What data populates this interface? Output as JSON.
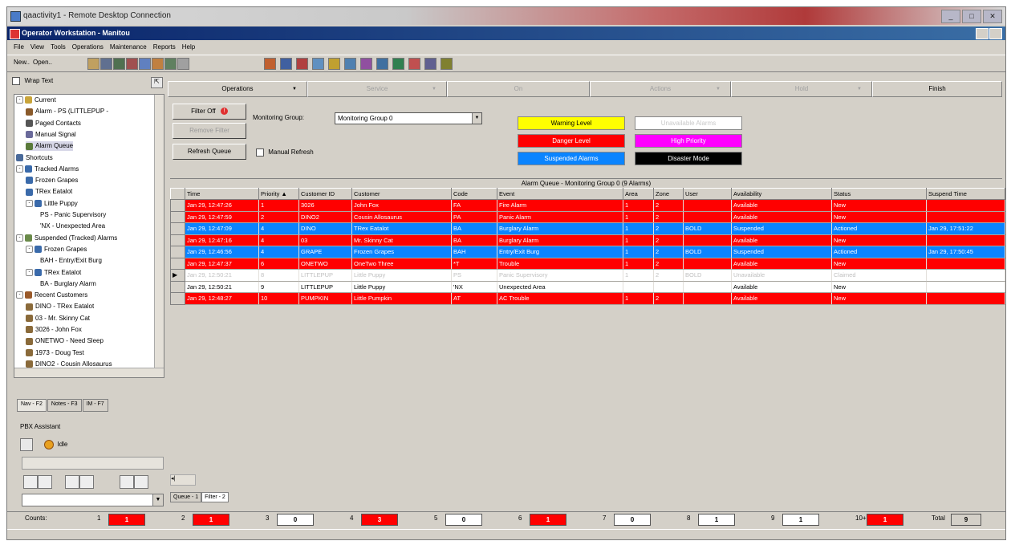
{
  "rdp_window": {
    "title": "qaactivity1 - Remote Desktop Connection"
  },
  "app_window": {
    "title": "Operator Workstation - Manitou"
  },
  "menu": [
    "File",
    "View",
    "Tools",
    "Operations",
    "Maintenance",
    "Reports",
    "Help"
  ],
  "toolbar": {
    "new_label": "New..",
    "open_label": "Open.."
  },
  "left": {
    "wrap_text_label": "Wrap Text",
    "tree": [
      {
        "label": "Current",
        "level": 0,
        "expander": "-",
        "color": "#c9a43a"
      },
      {
        "label": "Alarm - PS (LITTLEPUP -",
        "level": 1,
        "color": "#8a5a2a"
      },
      {
        "label": "Paged Contacts",
        "level": 1,
        "color": "#555555"
      },
      {
        "label": "Manual Signal",
        "level": 1,
        "color": "#6a6a9a"
      },
      {
        "label": "Alarm Queue",
        "level": 1,
        "color": "#5a7a3a",
        "selected": true
      },
      {
        "label": "Shortcuts",
        "level": 0,
        "color": "#4a6a9a"
      },
      {
        "label": "Tracked Alarms",
        "level": 0,
        "expander": "-",
        "color": "#3a6aaa"
      },
      {
        "label": "Frozen Grapes",
        "level": 1,
        "color": "#3a6aaa"
      },
      {
        "label": "TRex Eatalot",
        "level": 1,
        "color": "#3a6aaa"
      },
      {
        "label": "Little Puppy",
        "level": 1,
        "expander": "-",
        "color": "#3a6aaa"
      },
      {
        "label": "PS - Panic Supervisory",
        "level": 2,
        "color": ""
      },
      {
        "label": "'NX - Unexpected Area",
        "level": 2,
        "color": ""
      },
      {
        "label": "Suspended (Tracked) Alarms",
        "level": 0,
        "expander": "-",
        "color": "#6a8a4a"
      },
      {
        "label": "Frozen Grapes",
        "level": 1,
        "expander": "-",
        "color": "#3a6aaa"
      },
      {
        "label": "BAH - Entry/Exit Burg",
        "level": 2,
        "color": ""
      },
      {
        "label": "TRex Eatalot",
        "level": 1,
        "expander": "-",
        "color": "#3a6aaa"
      },
      {
        "label": "BA - Burglary Alarm",
        "level": 2,
        "color": ""
      },
      {
        "label": "Recent Customers",
        "level": 0,
        "expander": "-",
        "color": "#9a5a2a"
      },
      {
        "label": "DINO - TRex Eatalot",
        "level": 1,
        "color": "#8a6a3a"
      },
      {
        "label": "03 - Mr. Skinny Cat",
        "level": 1,
        "color": "#8a6a3a"
      },
      {
        "label": "3026 - John Fox",
        "level": 1,
        "color": "#8a6a3a"
      },
      {
        "label": "ONETWO - Need Sleep",
        "level": 1,
        "color": "#8a6a3a"
      },
      {
        "label": "1973 - Doug Test",
        "level": 1,
        "color": "#8a6a3a"
      },
      {
        "label": "DINO2 - Cousin Allosaurus",
        "level": 1,
        "color": "#8a6a3a"
      }
    ],
    "nav_tabs": [
      "Nav - F2",
      "Notes - F3",
      "IM - F7"
    ],
    "pbx_title": "PBX Assistant",
    "pbx_status": "Idle"
  },
  "ops": {
    "tabs": [
      {
        "label": "Operations",
        "w": 174,
        "dis": false,
        "dd": true
      },
      {
        "label": "Service",
        "w": 174,
        "dis": true,
        "dd": true
      },
      {
        "label": "On",
        "w": 178,
        "dis": true,
        "dd": false
      },
      {
        "label": "Actions",
        "w": 176,
        "dis": true,
        "dd": true
      },
      {
        "label": "Hold",
        "w": 176,
        "dis": true,
        "dd": true
      },
      {
        "label": "Finish",
        "w": 162,
        "dis": false,
        "dd": false
      }
    ],
    "filter_off": "Filter Off",
    "remove_filter": "Remove Filter",
    "refresh_queue": "Refresh Queue",
    "monitoring_group_label": "Monitoring Group:",
    "monitoring_group_value": "Monitoring Group 0",
    "manual_refresh": "Manual Refresh"
  },
  "legend": [
    {
      "label": "Warning Level",
      "bg": "#ffff00",
      "fg": "#000000",
      "col": 0,
      "row": 0
    },
    {
      "label": "Unavailable Alarms",
      "bg": "#ffffff",
      "fg": "#c8c8c8",
      "col": 1,
      "row": 0
    },
    {
      "label": "Danger Level",
      "bg": "#ff0000",
      "fg": "#ffffff",
      "col": 0,
      "row": 1
    },
    {
      "label": "High Priority",
      "bg": "#ff00ff",
      "fg": "#ffffff",
      "col": 1,
      "row": 1
    },
    {
      "label": "Suspended Alarms",
      "bg": "#0a84ff",
      "fg": "#ffffff",
      "col": 0,
      "row": 2
    },
    {
      "label": "Disaster Mode",
      "bg": "#000000",
      "fg": "#ffffff",
      "col": 1,
      "row": 2
    }
  ],
  "queue": {
    "title": "Alarm Queue - Monitoring Group 0 (9 Alarms)",
    "columns": [
      "Time",
      "Priority ▲",
      "Customer ID",
      "Customer",
      "Code",
      "Event",
      "Area",
      "Zone",
      "User",
      "Availability",
      "Status",
      "Suspend Time"
    ],
    "rows": [
      {
        "type": "danger",
        "cells": [
          "Jan 29, 12:47:26",
          "1",
          "3026",
          "John Fox",
          "FA",
          "Fire Alarm",
          "1",
          "2",
          "",
          "Available",
          "New",
          ""
        ]
      },
      {
        "type": "danger",
        "cells": [
          "Jan 29, 12:47:59",
          "2",
          "DINO2",
          "Cousin Allosaurus",
          "PA",
          "Panic Alarm",
          "1",
          "2",
          "",
          "Available",
          "New",
          ""
        ]
      },
      {
        "type": "suspended",
        "cells": [
          "Jan 29, 12:47:09",
          "4",
          "DINO",
          "TRex Eatalot",
          "BA",
          "Burglary Alarm",
          "1",
          "2",
          "BOLD",
          "Suspended",
          "Actioned",
          "Jan 29, 17:51:22"
        ]
      },
      {
        "type": "danger",
        "cells": [
          "Jan 29, 12:47:16",
          "4",
          "03",
          "Mr. Skinny Cat",
          "BA",
          "Burglary Alarm",
          "1",
          "2",
          "",
          "Available",
          "New",
          ""
        ]
      },
      {
        "type": "suspended",
        "cells": [
          "Jan 29, 12:46:56",
          "4",
          "GRAPE",
          "Frozen Grapes",
          "BAH",
          "Entry/Exit Burg",
          "1",
          "2",
          "BOLD",
          "Suspended",
          "Actioned",
          "Jan 29, 17:50:45"
        ]
      },
      {
        "type": "danger",
        "cells": [
          "Jan 29, 12:47:37",
          "6",
          "ONETWO",
          "OneTwo Three",
          "*T",
          "Trouble",
          "1",
          "2",
          "",
          "Available",
          "New",
          ""
        ]
      },
      {
        "type": "unavailable",
        "selected": true,
        "cells": [
          "Jan 29, 12:50:21",
          "8",
          "LITTLEPUP",
          "Little Puppy",
          "PS",
          "Panic Supervisory",
          "1",
          "2",
          "BOLD",
          "Unavailable",
          "Claimed",
          ""
        ]
      },
      {
        "type": "normal",
        "cells": [
          "Jan 29, 12:50:21",
          "9",
          "LITTLEPUP",
          "Little Puppy",
          "'NX",
          "Unexpected Area",
          "",
          "",
          "",
          "Available",
          "New",
          ""
        ]
      },
      {
        "type": "danger",
        "cells": [
          "Jan 29, 12:48:27",
          "10",
          "PUMPKIN",
          "Little Pumpkin",
          "AT",
          "AC Trouble",
          "1",
          "2",
          "",
          "Available",
          "New",
          ""
        ]
      }
    ],
    "tabs": [
      "Queue - 1",
      "Filter - 2"
    ]
  },
  "counts": {
    "label": "Counts:",
    "items": [
      {
        "label": "1",
        "value": "1",
        "red": true
      },
      {
        "label": "2",
        "value": "1",
        "red": true
      },
      {
        "label": "3",
        "value": "0",
        "red": false
      },
      {
        "label": "4",
        "value": "3",
        "red": true
      },
      {
        "label": "5",
        "value": "0",
        "red": false
      },
      {
        "label": "6",
        "value": "1",
        "red": true
      },
      {
        "label": "7",
        "value": "0",
        "red": false
      },
      {
        "label": "8",
        "value": "1",
        "red": false
      },
      {
        "label": "9",
        "value": "1",
        "red": false
      },
      {
        "label": "10+",
        "value": "1",
        "red": true
      }
    ],
    "total_label": "Total",
    "total_value": "9"
  },
  "colors": {
    "danger": "#ff0000",
    "suspended": "#0a84ff",
    "normal": "#ffffff",
    "unavailable": "#ffffff"
  }
}
